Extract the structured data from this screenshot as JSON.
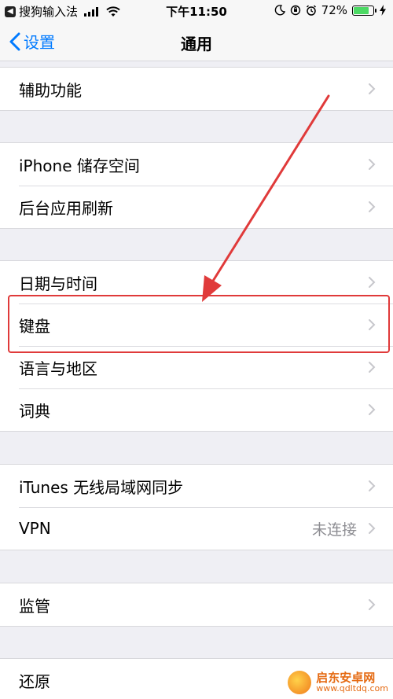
{
  "status_bar": {
    "carrier": "搜狗输入法",
    "time": "下午11:50",
    "battery": "72%",
    "battery_level": 0.72
  },
  "nav": {
    "back_label": "设置",
    "title": "通用"
  },
  "groups": [
    {
      "rows": [
        {
          "label": "辅助功能"
        }
      ]
    },
    {
      "rows": [
        {
          "label": "iPhone 储存空间"
        },
        {
          "label": "后台应用刷新"
        }
      ]
    },
    {
      "rows": [
        {
          "label": "日期与时间"
        },
        {
          "label": "键盘"
        },
        {
          "label": "语言与地区"
        },
        {
          "label": "词典"
        }
      ]
    },
    {
      "rows": [
        {
          "label": "iTunes 无线局域网同步"
        },
        {
          "label": "VPN",
          "detail": "未连接"
        }
      ]
    },
    {
      "rows": [
        {
          "label": "监管"
        }
      ]
    },
    {
      "rows": [
        {
          "label": "还原"
        }
      ]
    }
  ],
  "annotation": {
    "highlighted_row": "键盘",
    "color": "#e03a3a"
  },
  "watermark": {
    "name": "启东安卓网",
    "url": "www.qdltdq.com"
  },
  "colors": {
    "accent": "#007aff",
    "background": "#efeff4",
    "battery": "#4cd964"
  }
}
